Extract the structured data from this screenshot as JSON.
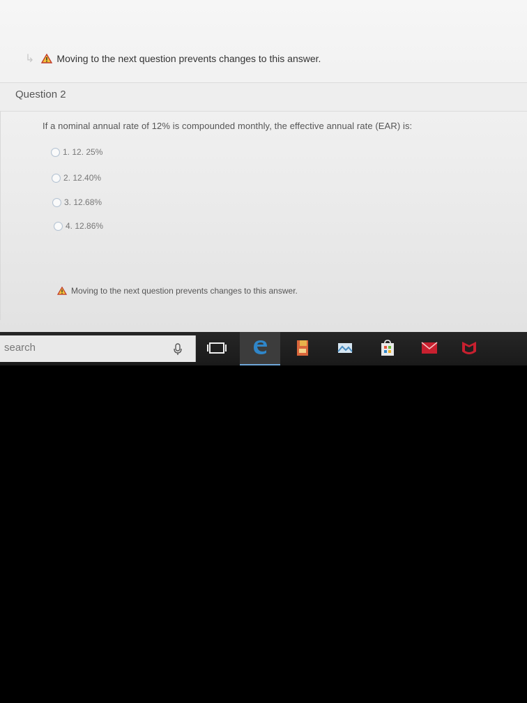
{
  "warning": {
    "text": "Moving to the next question prevents changes to this answer."
  },
  "question": {
    "title": "Question 2",
    "text": "If a nominal annual rate of 12% is compounded monthly, the effective annual rate (EAR) is:",
    "options": [
      {
        "label": "1. 12. 25%"
      },
      {
        "label": "2. 12.40%"
      },
      {
        "label": "3. 12.68%"
      },
      {
        "label": "4. 12.86%"
      }
    ]
  },
  "bottom_warning": {
    "text": "Moving to the next question prevents changes to this answer."
  },
  "taskbar": {
    "search_placeholder": "search",
    "icons": [
      "microphone-icon",
      "task-view-icon",
      "edge-icon",
      "file-explorer-icon",
      "photos-icon",
      "store-icon",
      "mail-icon",
      "mcafee-icon"
    ]
  },
  "colors": {
    "warning_red": "#c0392b",
    "taskbar_bg": "#1f1f1f",
    "edge_blue": "#2f86c9",
    "mcafee_red": "#c8202f"
  }
}
